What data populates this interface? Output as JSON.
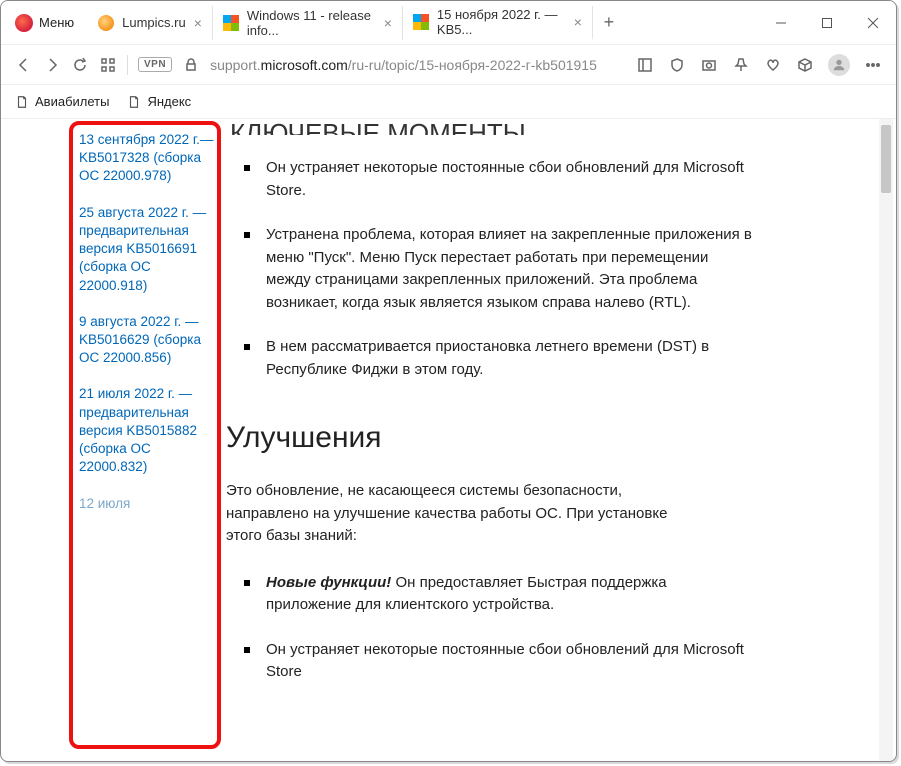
{
  "menu_label": "Меню",
  "tabs": [
    {
      "title": "Lumpics.ru"
    },
    {
      "title": "Windows 11 - release info..."
    },
    {
      "title": "15 ноября 2022 г. — KB5..."
    }
  ],
  "url_prefix": "support.",
  "url_host": "microsoft.com",
  "url_path": "/ru-ru/topic/15-ноября-2022-г-kb501915",
  "bookmarks": [
    {
      "label": "Авиабилеты"
    },
    {
      "label": "Яндекс"
    }
  ],
  "sidebar": {
    "items": [
      "13 сентября 2022 г.— KB5017328 (сборка ОС 22000.978)",
      "25 августа 2022 г. — предварительная версия KB5016691 (сборка ОС 22000.918)",
      "9 августа 2022 г. — KB5016629 (сборка ОС 22000.856)",
      "21 июля 2022 г. — предварительная версия KB5015882 (сборка ОС 22000.832)",
      "12 июля"
    ]
  },
  "heading_cut": "КЛЮЧЕВЫЕ МОМЕНТЫ",
  "bullets1": [
    "Он устраняет некоторые постоянные сбои обновлений для Microsoft Store.",
    "Устранена проблема, которая влияет на закрепленные приложения в меню \"Пуск\". Меню Пуск перестает работать при перемещении между страницами закрепленных приложений. Эта проблема возникает, когда язык является языком справа налево (RTL).",
    "В нем рассматривается приостановка летнего времени (DST) в Республике Фиджи в этом году."
  ],
  "section2": "Улучшения",
  "intro2": "Это обновление, не касающееся системы безопасности, направлено на улучшение качества работы ОС. При установке этого базы знаний:",
  "bullets2_boldlabel": "Новые функции!",
  "bullets2": [
    " Он предоставляет Быстрая поддержка приложение для клиентского устройства.",
    "Он устраняет некоторые постоянные сбои обновлений для Microsoft Store"
  ]
}
